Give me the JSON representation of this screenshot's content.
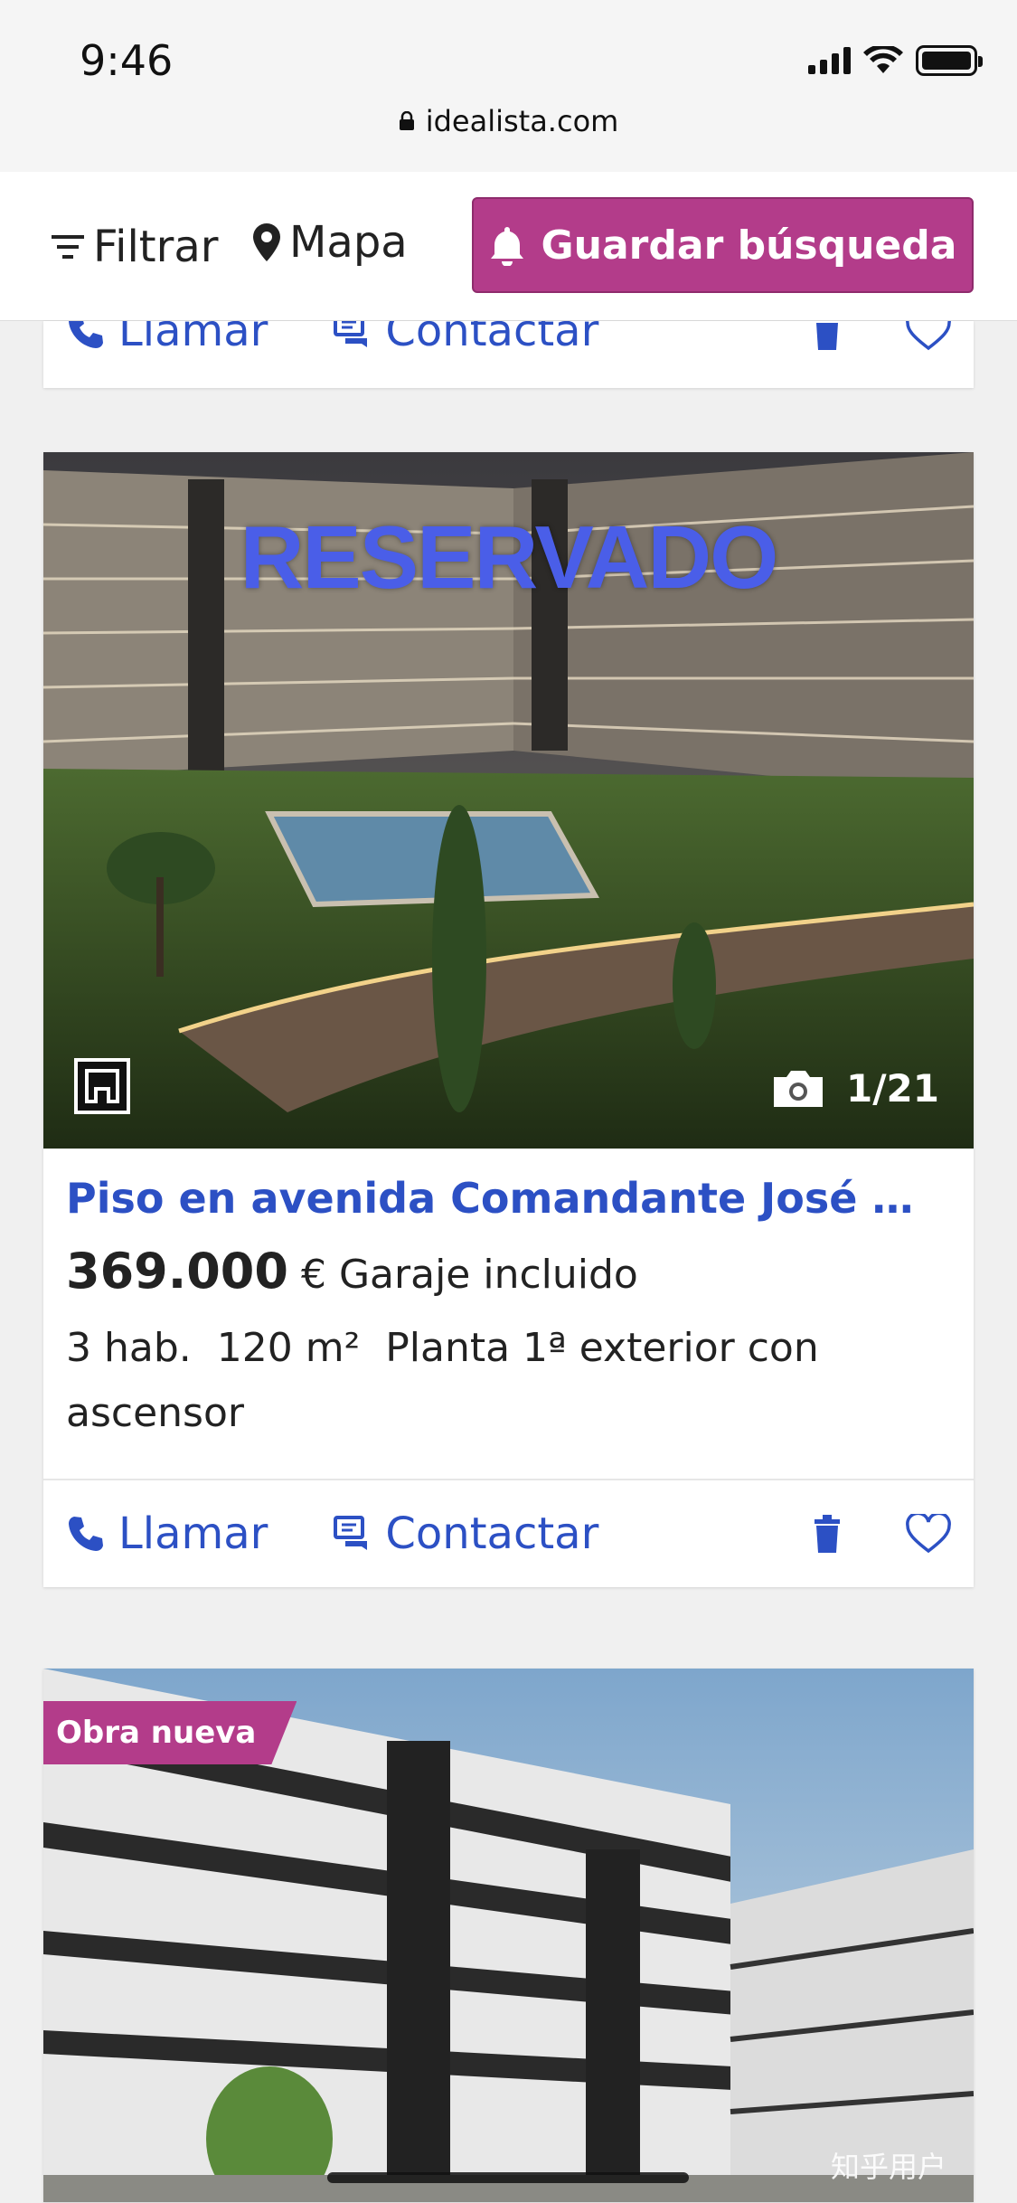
{
  "status_bar": {
    "time": "9:46"
  },
  "browser": {
    "url": "idealista.com"
  },
  "header": {
    "filter_label": "Filtrar",
    "map_label": "Mapa",
    "save_search_label": "Guardar búsqueda"
  },
  "prev_card": {
    "call_label": "Llamar",
    "contact_label": "Contactar"
  },
  "listing": {
    "photo_overlay_text": "RESERVADO",
    "photo_counter": "1/21",
    "title": "Piso en avenida Comandante José Man...",
    "price": "369.000",
    "currency": "€",
    "price_note": "Garaje incluido",
    "rooms": "3 hab.",
    "area": "120 m²",
    "floor": "Planta 1ª exterior con ascensor",
    "call_label": "Llamar",
    "contact_label": "Contactar"
  },
  "next_listing": {
    "badge": "Obra nueva",
    "watermark": "知乎用户"
  },
  "colors": {
    "accent": "#b33c8a",
    "link": "#2c50c4"
  }
}
